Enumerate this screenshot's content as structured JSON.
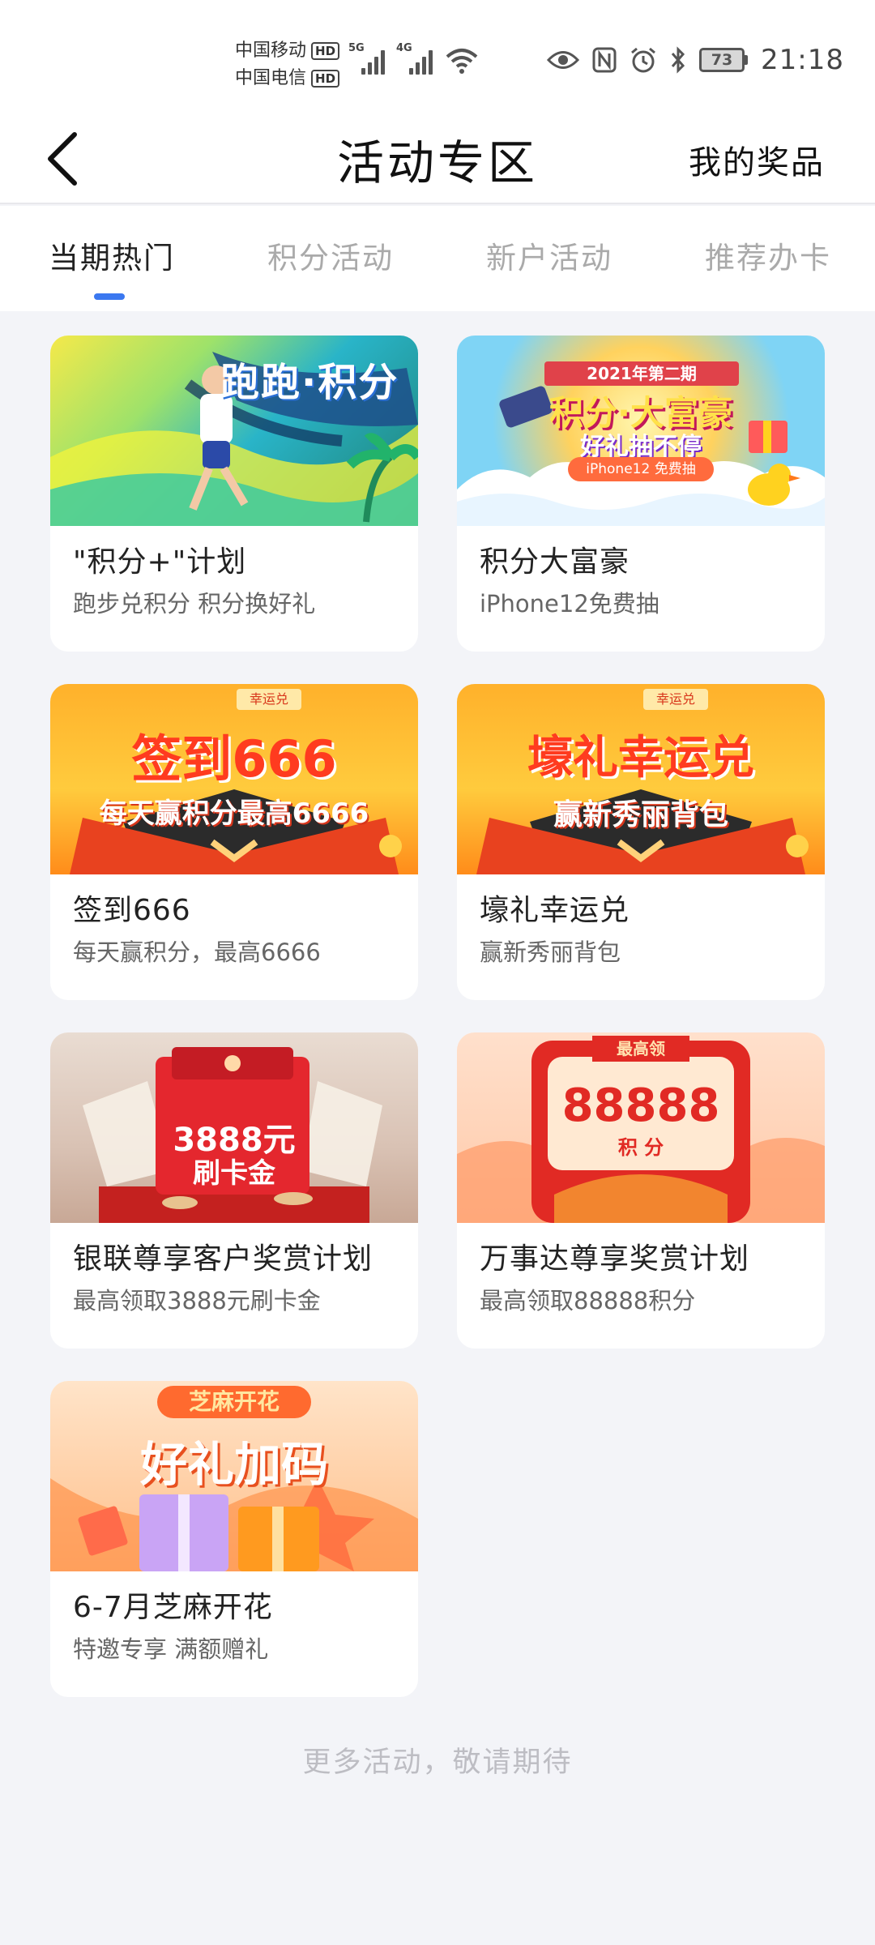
{
  "status_bar": {
    "carrier_1": "中国移动",
    "carrier_2": "中国电信",
    "hd_badge": "HD",
    "network_1": "5G",
    "network_2": "4G",
    "battery_level": "73",
    "time": "21:18"
  },
  "header": {
    "title": "活动专区",
    "right_action": "我的奖品"
  },
  "tabs": [
    {
      "label": "当期热门",
      "active": true
    },
    {
      "label": "积分活动",
      "active": false
    },
    {
      "label": "新户活动",
      "active": false
    },
    {
      "label": "推荐办卡",
      "active": false
    }
  ],
  "activities": [
    {
      "title": "\"积分+\"计划",
      "subtitle": "跑步兑积分 积分换好礼",
      "banner_text": "跑跑·积分"
    },
    {
      "title": "积分大富豪",
      "subtitle": "iPhone12免费抽",
      "banner_text": "积分·大富豪",
      "banner_sub": "好礼抽不停",
      "banner_top": "2021年第二期",
      "banner_pill": "iPhone12 免费抽"
    },
    {
      "title": "签到666",
      "subtitle": "每天赢积分，最高6666",
      "banner_text": "签到666",
      "banner_sub": "每天赢积分最高6666",
      "banner_tag": "幸运兑"
    },
    {
      "title": "壕礼幸运兑",
      "subtitle": "赢新秀丽背包",
      "banner_text": "壕礼幸运兑",
      "banner_sub": "赢新秀丽背包",
      "banner_tag": "幸运兑"
    },
    {
      "title": "银联尊享客户奖赏计划",
      "subtitle": "最高领取3888元刷卡金",
      "banner_text": "3888元",
      "banner_sub": "刷卡金"
    },
    {
      "title": "万事达尊享奖赏计划",
      "subtitle": "最高领取88888积分",
      "banner_text": "88888",
      "banner_sub": "积 分",
      "banner_tag": "最高领"
    },
    {
      "title": "6-7月芝麻开花",
      "subtitle": "特邀专享 满额赠礼",
      "banner_text": "好礼加码",
      "banner_tag": "芝麻开花"
    }
  ],
  "footer_text": "更多活动，敬请期待",
  "colors": {
    "accent": "#3b78f0",
    "background": "#f3f4f8"
  }
}
